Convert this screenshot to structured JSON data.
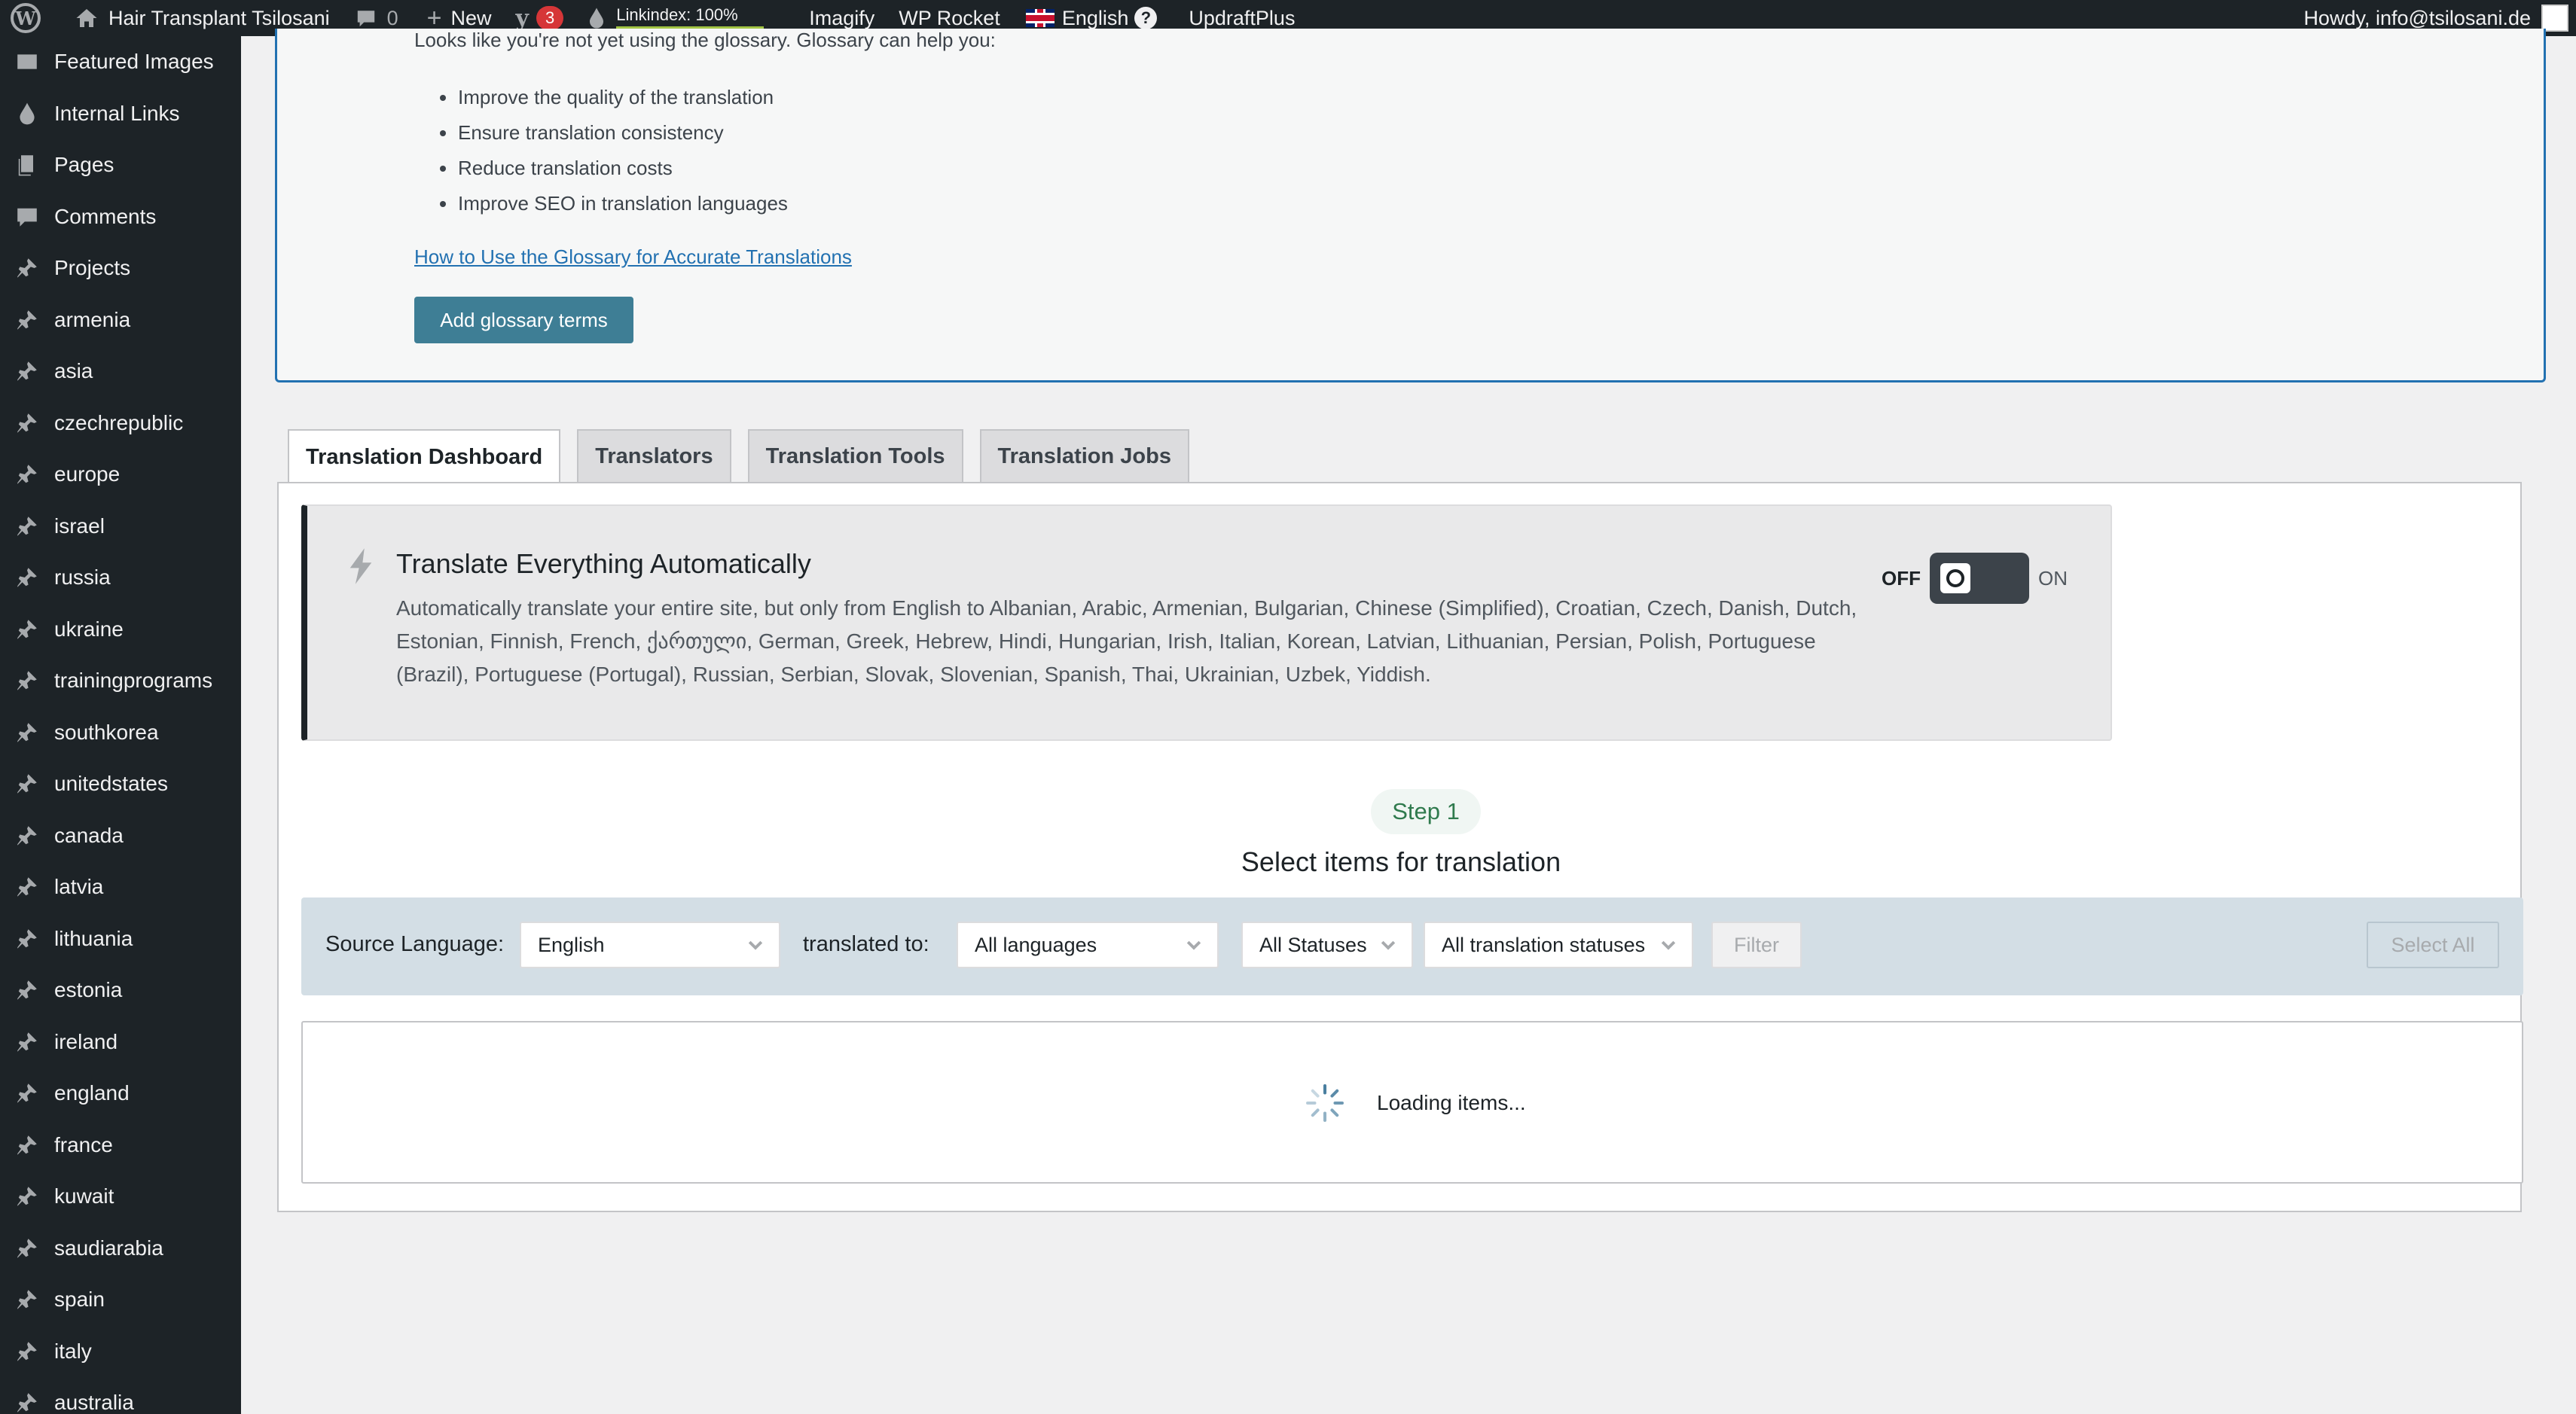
{
  "admin_bar": {
    "site_name": "Hair Transplant Tsilosani",
    "comments_count": "0",
    "new_label": "New",
    "yoast_badge": "3",
    "linkindex_label": "Linkindex: 100%",
    "linkindex_progress_percent": 100,
    "imagify_label": "Imagify",
    "wprocket_label": "WP Rocket",
    "language_label": "English",
    "help_glyph": "?",
    "updraft_label": "UpdraftPlus",
    "howdy_text": "Howdy, info@tsilosani.de"
  },
  "sidebar": {
    "items": [
      {
        "label": "Featured Images",
        "icon": "image-icon"
      },
      {
        "label": "Internal Links",
        "icon": "drop-icon"
      },
      {
        "label": "Pages",
        "icon": "pages-icon"
      },
      {
        "label": "Comments",
        "icon": "comment-icon"
      },
      {
        "label": "Projects",
        "icon": "pin-icon"
      },
      {
        "label": "armenia",
        "icon": "pin-icon"
      },
      {
        "label": "asia",
        "icon": "pin-icon"
      },
      {
        "label": "czechrepublic",
        "icon": "pin-icon"
      },
      {
        "label": "europe",
        "icon": "pin-icon"
      },
      {
        "label": "israel",
        "icon": "pin-icon"
      },
      {
        "label": "russia",
        "icon": "pin-icon"
      },
      {
        "label": "ukraine",
        "icon": "pin-icon"
      },
      {
        "label": "trainingprograms",
        "icon": "pin-icon"
      },
      {
        "label": "southkorea",
        "icon": "pin-icon"
      },
      {
        "label": "unitedstates",
        "icon": "pin-icon"
      },
      {
        "label": "canada",
        "icon": "pin-icon"
      },
      {
        "label": "latvia",
        "icon": "pin-icon"
      },
      {
        "label": "lithuania",
        "icon": "pin-icon"
      },
      {
        "label": "estonia",
        "icon": "pin-icon"
      },
      {
        "label": "ireland",
        "icon": "pin-icon"
      },
      {
        "label": "england",
        "icon": "pin-icon"
      },
      {
        "label": "france",
        "icon": "pin-icon"
      },
      {
        "label": "kuwait",
        "icon": "pin-icon"
      },
      {
        "label": "saudiarabia",
        "icon": "pin-icon"
      },
      {
        "label": "spain",
        "icon": "pin-icon"
      },
      {
        "label": "italy",
        "icon": "pin-icon"
      },
      {
        "label": "australia",
        "icon": "pin-icon"
      }
    ]
  },
  "glossary": {
    "intro": "Looks like you're not yet using the glossary. Glossary can help you:",
    "benefits": [
      "Improve the quality of the translation",
      "Ensure translation consistency",
      "Reduce translation costs",
      "Improve SEO in translation languages"
    ],
    "link_text": "How to Use the Glossary for Accurate Translations",
    "button_label": "Add glossary terms"
  },
  "tabs": [
    {
      "label": "Translation Dashboard",
      "active": true
    },
    {
      "label": "Translators",
      "active": false
    },
    {
      "label": "Translation Tools",
      "active": false
    },
    {
      "label": "Translation Jobs",
      "active": false
    }
  ],
  "auto_translate": {
    "title": "Translate Everything Automatically",
    "description": "Automatically translate your entire site, but only from English to Albanian, Arabic, Armenian, Bulgarian, Chinese (Simplified), Croatian, Czech, Danish, Dutch, Estonian, Finnish, French, ქართული, German, Greek, Hebrew, Hindi, Hungarian, Irish, Italian, Korean, Latvian, Lithuanian, Persian, Polish, Portuguese (Brazil), Portuguese (Portugal), Russian, Serbian, Slovak, Slovenian, Spanish, Thai, Ukrainian, Uzbek, Yiddish.",
    "toggle_off_label": "OFF",
    "toggle_on_label": "ON",
    "toggle_state": "off"
  },
  "step": {
    "badge": "Step 1",
    "title": "Select items for translation"
  },
  "filters": {
    "source_label": "Source Language:",
    "source_value": "English",
    "target_label": "translated to:",
    "target_value": "All languages",
    "status_value": "All Statuses",
    "translation_status_value": "All translation statuses",
    "filter_button": "Filter",
    "select_all_button": "Select All"
  },
  "items": {
    "loading_text": "Loading items..."
  },
  "colors": {
    "admin_bar_bg": "#1d2327",
    "accent_blue": "#2271b1",
    "glossary_button": "#3e7e95",
    "filter_bar_bg": "#d3dee5",
    "badge_red": "#d63638",
    "step_green": "#2f7a4d",
    "linkindex_green": "#a2c444"
  }
}
